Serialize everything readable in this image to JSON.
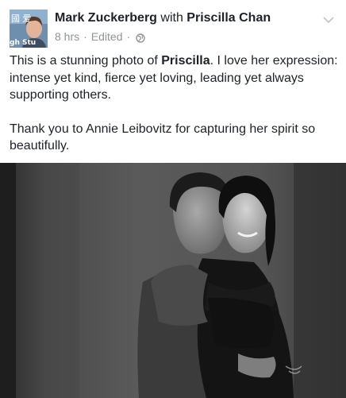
{
  "post": {
    "author": "Mark Zuckerberg",
    "with_word": "with",
    "tagged": "Priscilla Chan",
    "time": "8 hrs",
    "edited": "Edited",
    "separator": "·",
    "privacy_icon": "globe-icon",
    "menu_icon": "chevron-down-icon",
    "text": {
      "p1_before": "This is a stunning photo of ",
      "p1_name": "Priscilla",
      "p1_after": ". I love her expression: intense yet kind, fierce yet loving, leading yet always supporting others.",
      "p2": "Thank you to Annie Leibovitz for capturing her spirit so beautifully."
    },
    "avatar_text": {
      "line1": "國 爱",
      "line2": "gh Stu"
    }
  },
  "colors": {
    "text": "#1d2129",
    "meta": "#90949c",
    "photo_bg": "#3a3a3a"
  }
}
